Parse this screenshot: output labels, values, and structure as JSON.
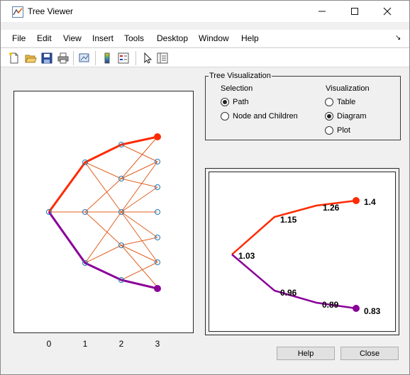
{
  "window": {
    "title": "Tree Viewer",
    "controls": {
      "minimize": "—",
      "maximize": "☐",
      "close": "✕"
    }
  },
  "menu": {
    "items": [
      "File",
      "Edit",
      "View",
      "Insert",
      "Tools",
      "Desktop",
      "Window",
      "Help"
    ],
    "overflow_icon": "dock-arrow-icon"
  },
  "toolbar": {
    "icons": [
      "new-figure-icon",
      "open-file-icon",
      "save-icon",
      "print-icon",
      "link-plot-icon",
      "colorbar-icon",
      "legend-icon",
      "pointer-icon",
      "property-inspector-icon"
    ]
  },
  "axes": {
    "xticks": [
      "0",
      "1",
      "2",
      "3"
    ]
  },
  "tree_visualization": {
    "title": "Tree Visualization",
    "selection": {
      "label": "Selection",
      "options": [
        "Path",
        "Node and Children"
      ],
      "selected": "Path"
    },
    "visualization": {
      "label": "Visualization",
      "options": [
        "Table",
        "Diagram",
        "Plot"
      ],
      "selected": "Diagram"
    }
  },
  "diagram": {
    "root_value": "1.03",
    "up_path": [
      "1.15",
      "1.26",
      "1.4"
    ],
    "down_path": [
      "0.96",
      "0.89",
      "0.83"
    ]
  },
  "buttons": {
    "help": "Help",
    "close": "Close"
  },
  "colors": {
    "up_path": "#ff2a00",
    "down_path": "#8a0099",
    "lattice": "#e06020",
    "node": "#1f77b4"
  }
}
